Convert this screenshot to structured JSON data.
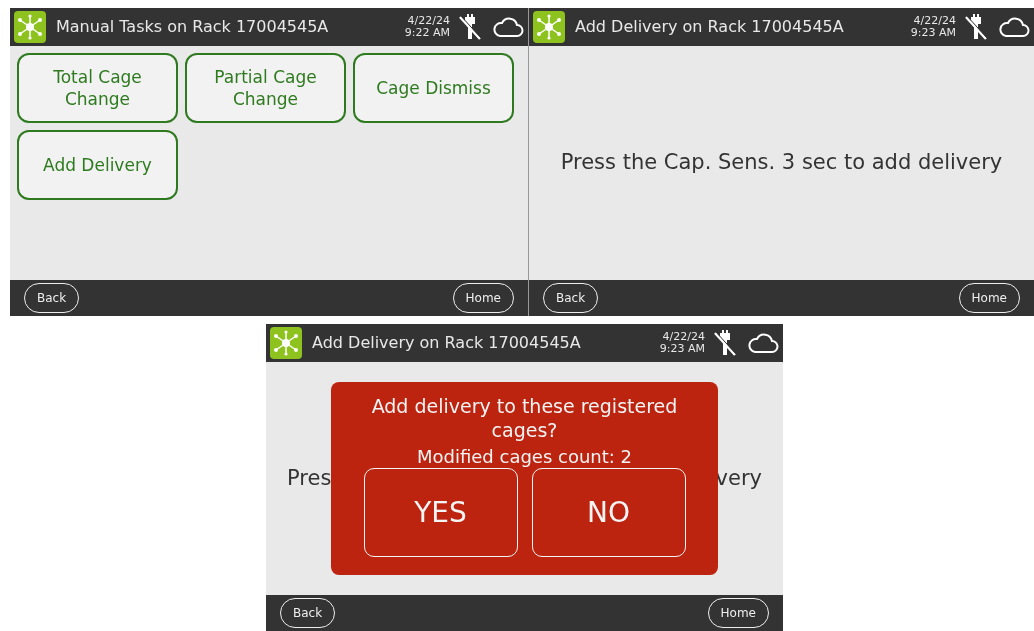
{
  "screens": [
    {
      "kind": "menu",
      "title": "Manual Tasks on Rack 17004545A",
      "date": "4/22/24",
      "time": "9:22 AM",
      "tasks": [
        "Total Cage Change",
        "Partial Cage Change",
        "Cage Dismiss",
        "Add Delivery"
      ],
      "back": "Back",
      "home": "Home"
    },
    {
      "kind": "message",
      "title": "Add Delivery on Rack 17004545A",
      "date": "4/22/24",
      "time": "9:23 AM",
      "message": "Press the Cap. Sens. 3 sec to add delivery",
      "back": "Back",
      "home": "Home"
    },
    {
      "kind": "dialog",
      "title": "Add Delivery on Rack 17004545A",
      "date": "4/22/24",
      "time": "9:23 AM",
      "message_left": "Pres",
      "message_right": "very",
      "dialog": {
        "question": "Add delivery to these registered cages?",
        "count": "Modified cages count: 2",
        "yes": "YES",
        "no": "NO"
      },
      "back": "Back",
      "home": "Home"
    }
  ]
}
